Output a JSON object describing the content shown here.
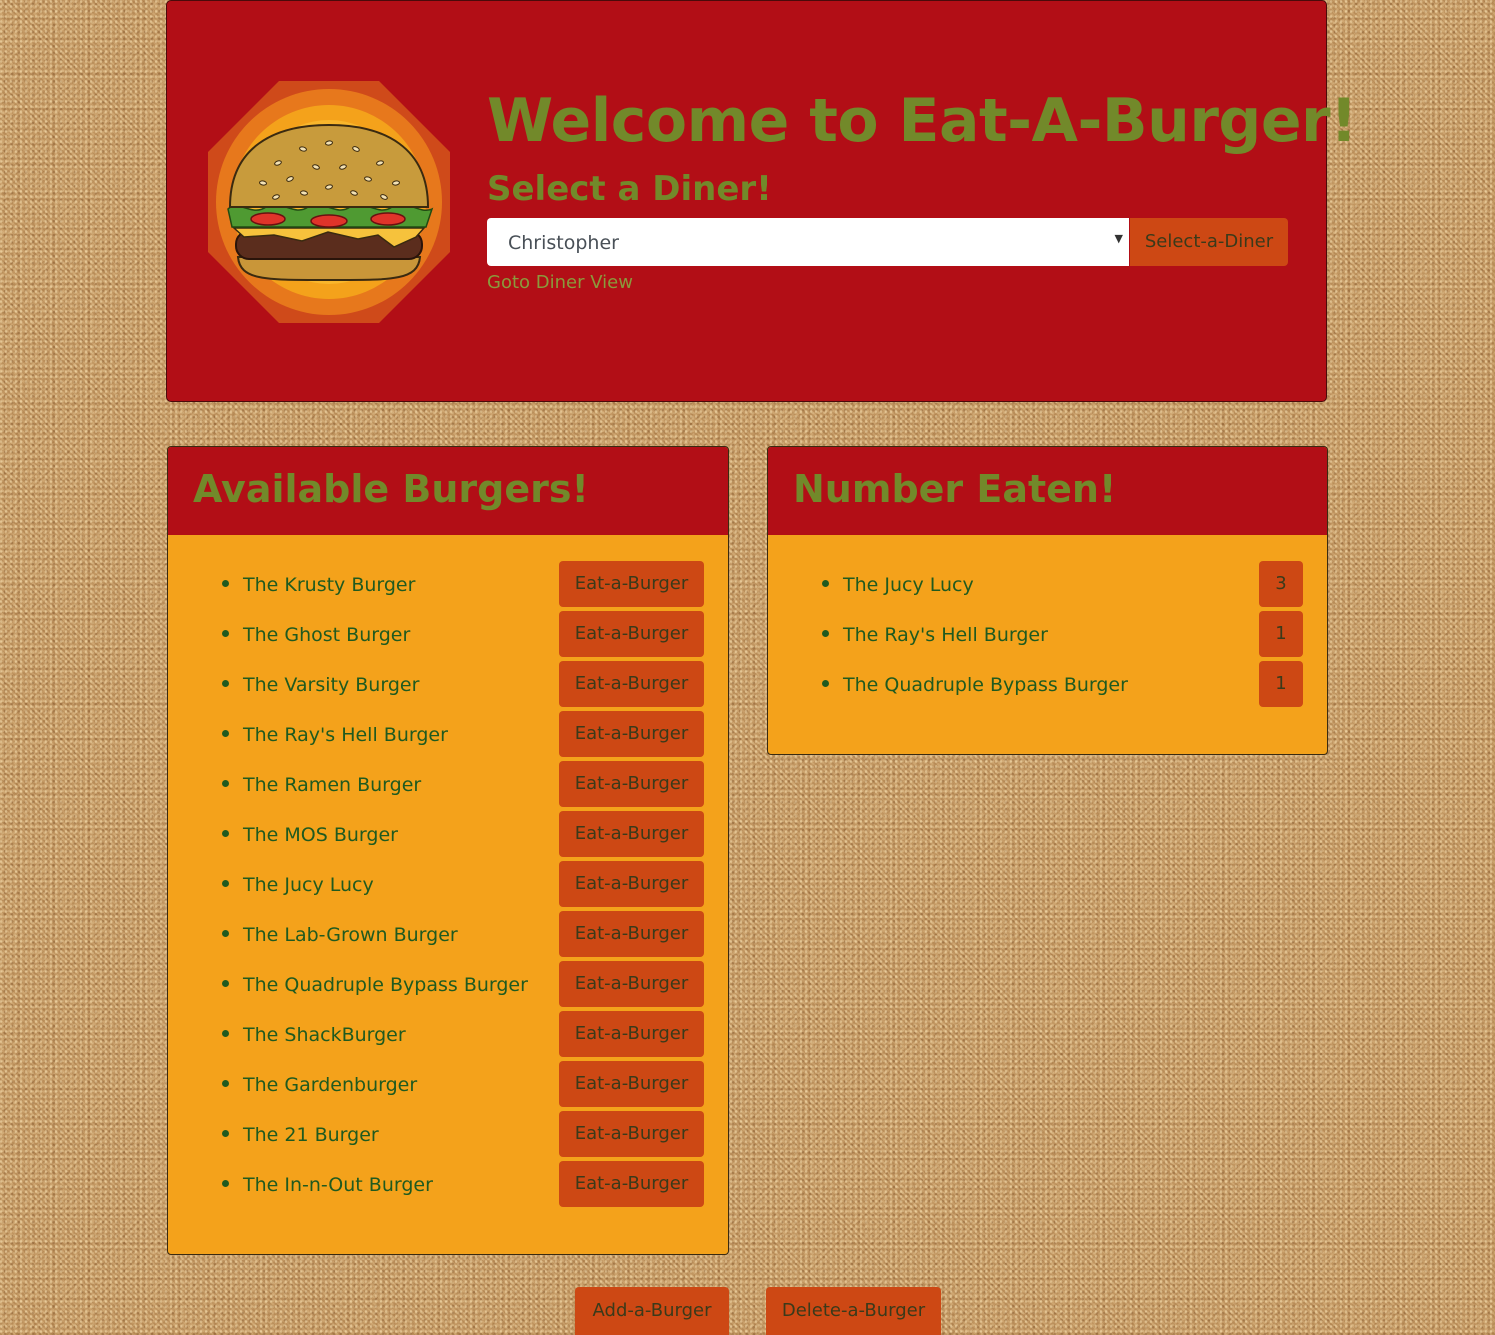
{
  "header": {
    "title": "Welcome to Eat-A-Burger!",
    "subtitle": "Select a Diner!",
    "diner_select": {
      "selected": "Christopher"
    },
    "select_button_label": "Select-a-Diner",
    "goto_link_label": "Goto Diner View"
  },
  "available": {
    "title": "Available Burgers!",
    "button_label": "Eat-a-Burger",
    "items": [
      "The Krusty Burger",
      "The Ghost Burger",
      "The Varsity Burger",
      "The Ray's Hell Burger",
      "The Ramen Burger",
      "The MOS Burger",
      "The Jucy Lucy",
      "The Lab-Grown Burger",
      "The Quadruple Bypass Burger",
      "The ShackBurger",
      "The Gardenburger",
      "The 21 Burger",
      "The In-n-Out Burger"
    ]
  },
  "eaten": {
    "title": "Number Eaten!",
    "items": [
      {
        "name": "The Jucy Lucy",
        "count": "3"
      },
      {
        "name": "The Ray's Hell Burger",
        "count": "1"
      },
      {
        "name": "The Quadruple Bypass Burger",
        "count": "1"
      }
    ]
  },
  "footer": {
    "add_button_label": "Add-a-Burger",
    "delete_button_label": "Delete-a-Burger"
  },
  "colors": {
    "header_red": "#b20e16",
    "title_green": "#72892a",
    "card_orange": "#f4a21b",
    "button_orange": "#cd4814",
    "item_text_green": "#1f5a1f"
  },
  "icons": {
    "logo": "burger-logo-icon",
    "select_caret": "caret-down-icon"
  }
}
